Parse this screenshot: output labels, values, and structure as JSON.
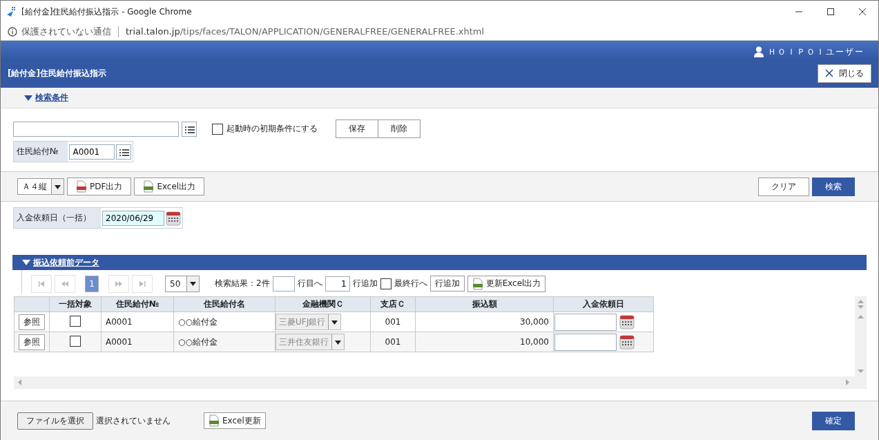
{
  "window": {
    "title": "[給付金]住民給付振込指示 - Google Chrome"
  },
  "address_bar": {
    "security_text": "保護されていない通信",
    "url_host": "trial.talon.jp",
    "url_path": "/tips/faces/TALON/APPLICATION/GENERALFREE/GENERALFREE.xhtml"
  },
  "header": {
    "user": "ＨＯＩＰＯＩユーザー",
    "title": "[給付金]住民給付振込指示",
    "close_button": "閉じる"
  },
  "search_section": {
    "label": "検索条件",
    "expanded": true
  },
  "search": {
    "save_default": {
      "label": "起動時の初期条件にする",
      "checked": false
    },
    "buttons": [
      "保存",
      "削除"
    ],
    "fields": [
      {
        "label": "住民給付№",
        "value": "A0001"
      }
    ]
  },
  "toolbar": {
    "paper_size": "Ａ４縦",
    "exports": [
      {
        "kind": "pdf",
        "label": "PDF出力"
      },
      {
        "kind": "excel",
        "label": "Excel出力"
      }
    ],
    "clear_button": "クリア",
    "search_button": "検索"
  },
  "bulk_date": {
    "label": "入金依頼日（一括）",
    "value": "2020/06/29"
  },
  "data_section": {
    "label": "振込依頼前データ",
    "expanded": true
  },
  "pager": {
    "pages": [
      {
        "label": "1",
        "selected": true
      }
    ],
    "page_size": "50",
    "result": "検索結果：2件",
    "goto_suffix": "行目へ",
    "add_count": "1",
    "add_suffix": "行追加",
    "last_row": {
      "label": "最終行へ",
      "checked": false
    },
    "add_button": "行追加",
    "export_button": "更新Excel出力"
  },
  "table": {
    "columns": [
      "一括対象",
      "住民給付№",
      "住民給付名",
      "金融機関Ｃ",
      "支店Ｃ",
      "振込額",
      "入金依頼日"
    ],
    "rows": [
      {
        "ref": "参照",
        "checked": false,
        "no": "A0001",
        "name": "○○給付金",
        "bank": "三菱UFJ銀行",
        "branch": "001",
        "amount": "30,000"
      },
      {
        "ref": "参照",
        "checked": false,
        "no": "A0001",
        "name": "○○給付金",
        "bank": "三井住友銀行",
        "branch": "001",
        "amount": "10,000"
      }
    ]
  },
  "footer": {
    "file_button": "ファイルを選択",
    "file_status": "選択されていません",
    "excel_update": "Excel更新",
    "confirm": "確定"
  }
}
